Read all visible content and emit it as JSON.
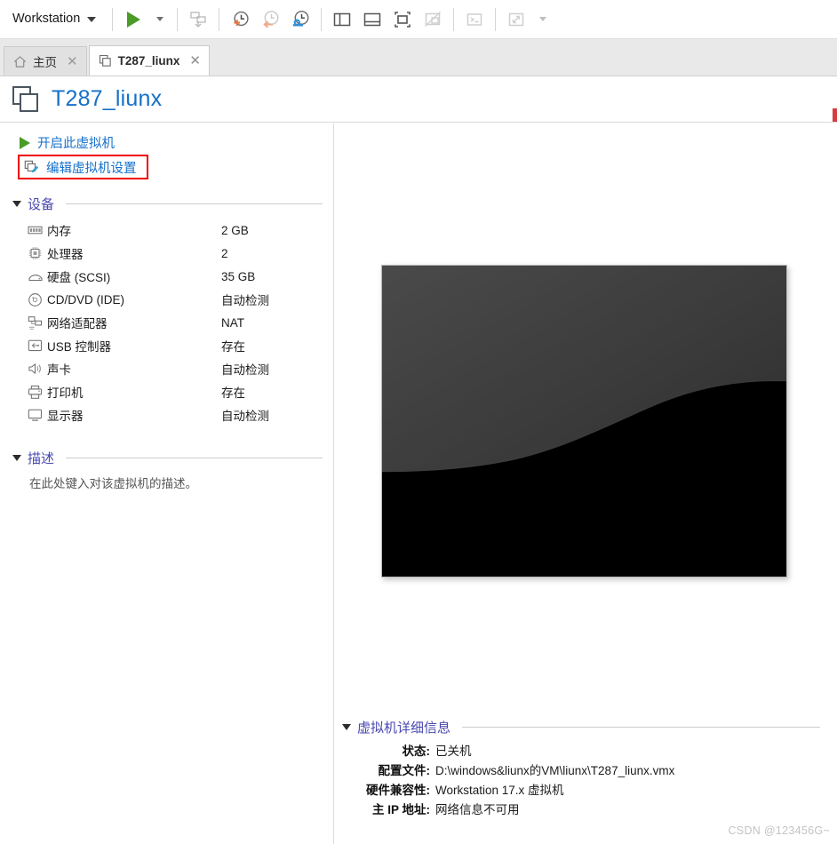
{
  "toolbar": {
    "app_menu_label": "Workstation",
    "buttons": [
      {
        "name": "power-on-button",
        "icon": "play-icon",
        "enabled": true
      },
      {
        "name": "power-options-dropdown",
        "icon": "chevron-down-icon",
        "enabled": true
      },
      {
        "name": "send-ctrl-alt-del-button",
        "icon": "send-key-icon",
        "enabled": false
      },
      {
        "name": "take-snapshot-button",
        "icon": "snapshot-add-icon",
        "enabled": true
      },
      {
        "name": "revert-snapshot-button",
        "icon": "snapshot-revert-icon",
        "enabled": false
      },
      {
        "name": "snapshot-manager-button",
        "icon": "snapshot-manager-icon",
        "enabled": true
      },
      {
        "name": "show-library-button",
        "icon": "library-panel-icon",
        "enabled": true
      },
      {
        "name": "show-thumbnail-bar-button",
        "icon": "thumbnail-bar-icon",
        "enabled": true
      },
      {
        "name": "enter-fullscreen-button",
        "icon": "fullscreen-icon",
        "enabled": true
      },
      {
        "name": "unity-mode-button",
        "icon": "unity-mode-icon",
        "enabled": false
      },
      {
        "name": "console-button",
        "icon": "terminal-icon",
        "enabled": false
      },
      {
        "name": "stretch-guest-button",
        "icon": "stretch-icon",
        "enabled": false
      },
      {
        "name": "stretch-options-dropdown",
        "icon": "chevron-down-icon",
        "enabled": false
      }
    ]
  },
  "tabs": [
    {
      "label": "主页",
      "icon": "home-icon",
      "active": false,
      "close_label": "✕"
    },
    {
      "label": "T287_liunx",
      "icon": "vm-icon",
      "active": true,
      "close_label": "✕"
    }
  ],
  "header": {
    "title": "T287_liunx",
    "icon": "vm-icon"
  },
  "actions": [
    {
      "label": "开启此虚拟机",
      "icon": "play-icon",
      "highlighted": false
    },
    {
      "label": "编辑虚拟机设置",
      "icon": "edit-settings-icon",
      "highlighted": true
    }
  ],
  "devices_section": {
    "title": "设备",
    "expanded": true,
    "items": [
      {
        "icon": "memory-icon",
        "name": "内存",
        "value": "2 GB"
      },
      {
        "icon": "cpu-icon",
        "name": "处理器",
        "value": "2"
      },
      {
        "icon": "disk-icon",
        "name": "硬盘 (SCSI)",
        "value": "35 GB"
      },
      {
        "icon": "cd-dvd-icon",
        "name": "CD/DVD (IDE)",
        "value": "自动检测"
      },
      {
        "icon": "network-icon",
        "name": "网络适配器",
        "value": "NAT"
      },
      {
        "icon": "usb-icon",
        "name": "USB 控制器",
        "value": "存在"
      },
      {
        "icon": "sound-icon",
        "name": "声卡",
        "value": "自动检测"
      },
      {
        "icon": "printer-icon",
        "name": "打印机",
        "value": "存在"
      },
      {
        "icon": "display-icon",
        "name": "显示器",
        "value": "自动检测"
      }
    ]
  },
  "description_section": {
    "title": "描述",
    "expanded": true,
    "placeholder": "在此处键入对该虚拟机的描述。"
  },
  "preview": {
    "name": "vm-preview-thumbnail"
  },
  "details_section": {
    "title": "虚拟机详细信息",
    "expanded": true,
    "rows": [
      {
        "label": "状态:",
        "value": "已关机"
      },
      {
        "label": "配置文件:",
        "value": "D:\\windows&liunx的VM\\liunx\\T287_liunx.vmx"
      },
      {
        "label": "硬件兼容性:",
        "value": "Workstation 17.x 虚拟机"
      },
      {
        "label": "主 IP 地址:",
        "value": "网络信息不可用"
      }
    ]
  },
  "watermark": "CSDN @123456G~",
  "colors": {
    "link_blue": "#1570c9",
    "section_purple": "#4848b0",
    "play_green": "#4a9b27",
    "highlight_red": "#ee0000",
    "snapshot_orange": "#e8743b",
    "snapshot_blue": "#2f8fd6"
  }
}
